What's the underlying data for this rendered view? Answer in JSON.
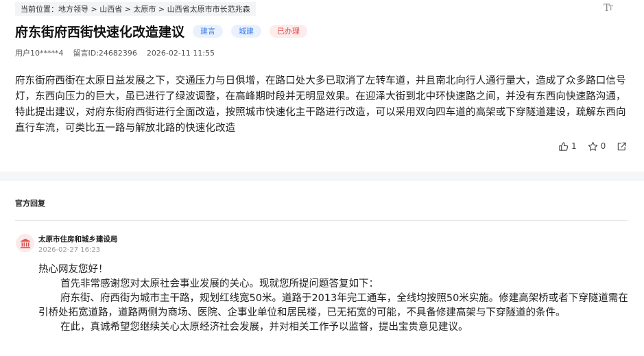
{
  "breadcrumb": "当前位置：地方领导 > 山西省 > 太原市 > 山西省太原市市长范兆森",
  "font_toggle_icon": "text-size-icon",
  "post": {
    "title": "府东街府西街快速化改造建议",
    "tags": [
      "建言",
      "城建",
      "已办理"
    ],
    "user": "用户10*****4",
    "message_id": "留言ID:24682396",
    "datetime": "2026-02-11 11:55",
    "body": "府东街府西街在太原日益发展之下，交通压力与日俱增，在路口处大多已取消了左转车道，并且南北向行人通行量大，造成了众多路口信号灯，东西向压力的巨大，虽已进行了绿波调整，在高峰期时段并无明显效果。在迎泽大街到北中环快速路之间，并没有东西向快速路沟通，特此提出建议，对府东街府西街进行全面改造，按照城市快速化主干路进行改造，可以采用双向四车道的高架或下穿隧道建设，疏解东西向直行车流，可类比五一路与解放北路的快速化改造",
    "likes": "1",
    "favorites": "0"
  },
  "colors": {
    "tag_blue_bg": "#eaf1fe",
    "tag_blue_text": "#3d7ee8",
    "tag_red_bg": "#fdecec",
    "tag_red_text": "#e14b4b"
  },
  "reply_section": {
    "heading": "官方回复",
    "department": "太原市住房和城乡建设局",
    "date": "2026-02-27 16:23",
    "greeting": "热心网友您好！",
    "paragraphs": [
      "首先非常感谢您对太原社会事业发展的关心。现就您所提问题答复如下：",
      "府东街、府西街为城市主干路，规划红线宽50米。道路于2013年完工通车，全线均按照50米实施。修建高架桥或者下穿隧道需在引桥处拓宽道路，道路两侧为商场、医院、企事业单位和居民楼，已无拓宽的可能，不具备修建高架与下穿隧道的条件。",
      "在此，真诚希望您继续关心太原经济社会发展，并对相关工作予以监督，提出宝贵意见建议。"
    ]
  }
}
